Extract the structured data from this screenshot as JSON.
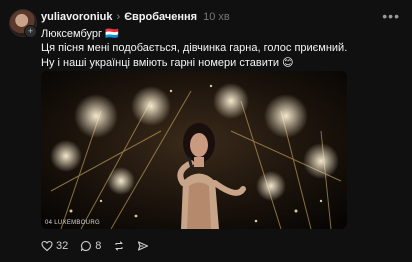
{
  "post": {
    "username": "yuliavoroniuk",
    "topic": "Євробачення",
    "time": "10 хв",
    "more": "•••",
    "text_lines": [
      "Люксембург 🇱🇺",
      "Ця пісня мені подобається, дівчинка гарна, голос приємний.",
      "Ну і наші українці вміють гарні номери ставити 😊"
    ],
    "media_caption": "04 LUXEMBOURG"
  },
  "actions": {
    "likes": "32",
    "replies": "8"
  },
  "icons": [
    "avatar",
    "plus-icon",
    "chevron-right-icon",
    "more-icon",
    "heart-icon",
    "comment-icon",
    "repost-icon",
    "share-icon"
  ]
}
